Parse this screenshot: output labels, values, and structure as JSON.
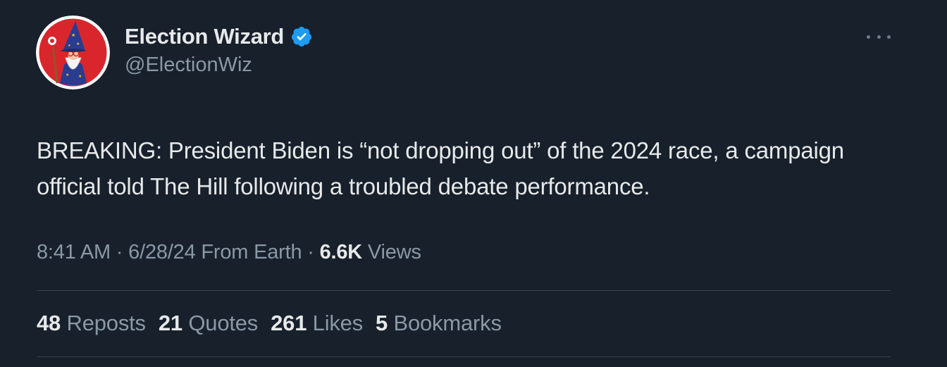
{
  "author": {
    "display_name": "Election Wizard",
    "handle": "@ElectionWiz",
    "verified": true,
    "avatar_icon": "wizard-avatar-icon"
  },
  "more_icon": "more-horizontal-icon",
  "tweet": {
    "text": "BREAKING: President Biden is “not dropping out” of the 2024 race, a campaign official told The Hill following a troubled debate performance."
  },
  "meta": {
    "time": "8:41 AM",
    "sep1": " · ",
    "date": "6/28/24",
    "source": "From Earth",
    "sep2": " · ",
    "views_count": "6.6K",
    "views_label": "Views"
  },
  "stats": {
    "reposts_count": "48",
    "reposts_label": "Reposts",
    "quotes_count": "21",
    "quotes_label": "Quotes",
    "likes_count": "261",
    "likes_label": "Likes",
    "bookmarks_count": "5",
    "bookmarks_label": "Bookmarks"
  },
  "colors": {
    "background": "#17202b",
    "text_primary": "#e7e9ea",
    "text_secondary": "#8b98a5",
    "verified_blue": "#1d9bf0",
    "divider": "#38444d"
  }
}
